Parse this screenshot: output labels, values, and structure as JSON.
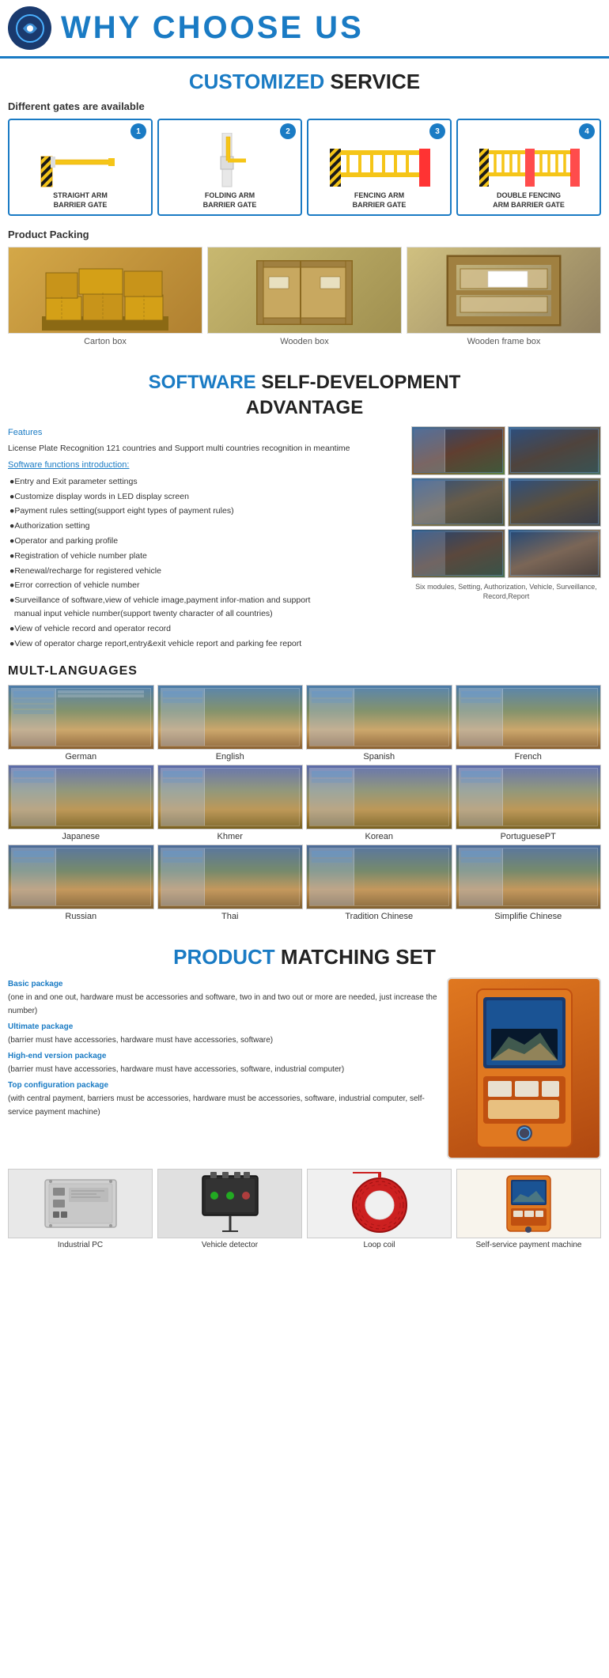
{
  "header": {
    "title": "WHY CHOOSE US"
  },
  "customized": {
    "section_title_colored": "CUSTOMIZED",
    "section_title_rest": " SERVICE",
    "sub_heading": "Different gates are available",
    "gates": [
      {
        "num": "1",
        "label": "STRAIGHT ARM\nBARRIER GATE"
      },
      {
        "num": "2",
        "label": "FOLDING ARM\nBARRIER GATE"
      },
      {
        "num": "3",
        "label": "FENCING ARM\nBARRIER GATE"
      },
      {
        "num": "4",
        "label": "DOUBLE FENCING\nARM BARRIER GATE"
      }
    ],
    "packing_label": "Product Packing",
    "packing_items": [
      {
        "label": "Carton box"
      },
      {
        "label": "Wooden box"
      },
      {
        "label": "Wooden frame box"
      }
    ]
  },
  "software": {
    "section_title_colored": "SOFTWARE",
    "section_title_rest": " SELF-DEVELOPMENT\nADVANTAGE",
    "features_label": "Features",
    "features_desc": "License Plate Recognition 121 countries and Support multi countries recognition in meantime",
    "intro_label": "Software functions introduction:",
    "functions": [
      "Entry and Exit parameter settings",
      "Customize display words in LED display screen",
      "Payment rules setting(support eight types of  payment rules)",
      "Authorization setting",
      "Operator and parking profile",
      "Registration of vehicle number plate",
      "Renewal/recharge for registered vehicle",
      "Error correction of vehicle number",
      "Surveillance of software,view of vehicle image,payment information and support manual input vehicle number(support twenty character of all countries)",
      "View of vehicle record and operator record",
      "View of operator charge report,entry&exit vehicle report and parking fee report"
    ],
    "screenshots_caption": "Six modules, Setting, Authorization, Vehicle, Surveillance, Record,Report"
  },
  "languages": {
    "title": "MULT-LANGUAGES",
    "items": [
      "German",
      "English",
      "Spanish",
      "French",
      "Japanese",
      "Khmer",
      "Korean",
      "PortuguesePT",
      "Russian",
      "Thai",
      "Tradition Chinese",
      "Simplifie Chinese"
    ]
  },
  "product": {
    "section_title_colored": "PRODUCT",
    "section_title_rest": " MATCHING SET",
    "packages": [
      {
        "label": "Basic package",
        "desc": "(one in and one out, hardware must be accessories and software, two in and two out or more are needed, just increase the number)"
      },
      {
        "label": "Ultimate package",
        "desc": "(barrier must have accessories, hardware must have accessories, software)"
      },
      {
        "label": "High-end version package",
        "desc": "(barrier must have accessories, hardware must have accessories, software, industrial computer)"
      },
      {
        "label": "Top configuration package",
        "desc": "(with central payment, barriers must be accessories, hardware must be accessories, software, industrial computer, self-service payment machine)"
      }
    ],
    "components": [
      {
        "label": "Industrial PC"
      },
      {
        "label": "Vehicle detector"
      },
      {
        "label": "Loop coil"
      },
      {
        "label": "Self-service payment machine"
      }
    ]
  }
}
